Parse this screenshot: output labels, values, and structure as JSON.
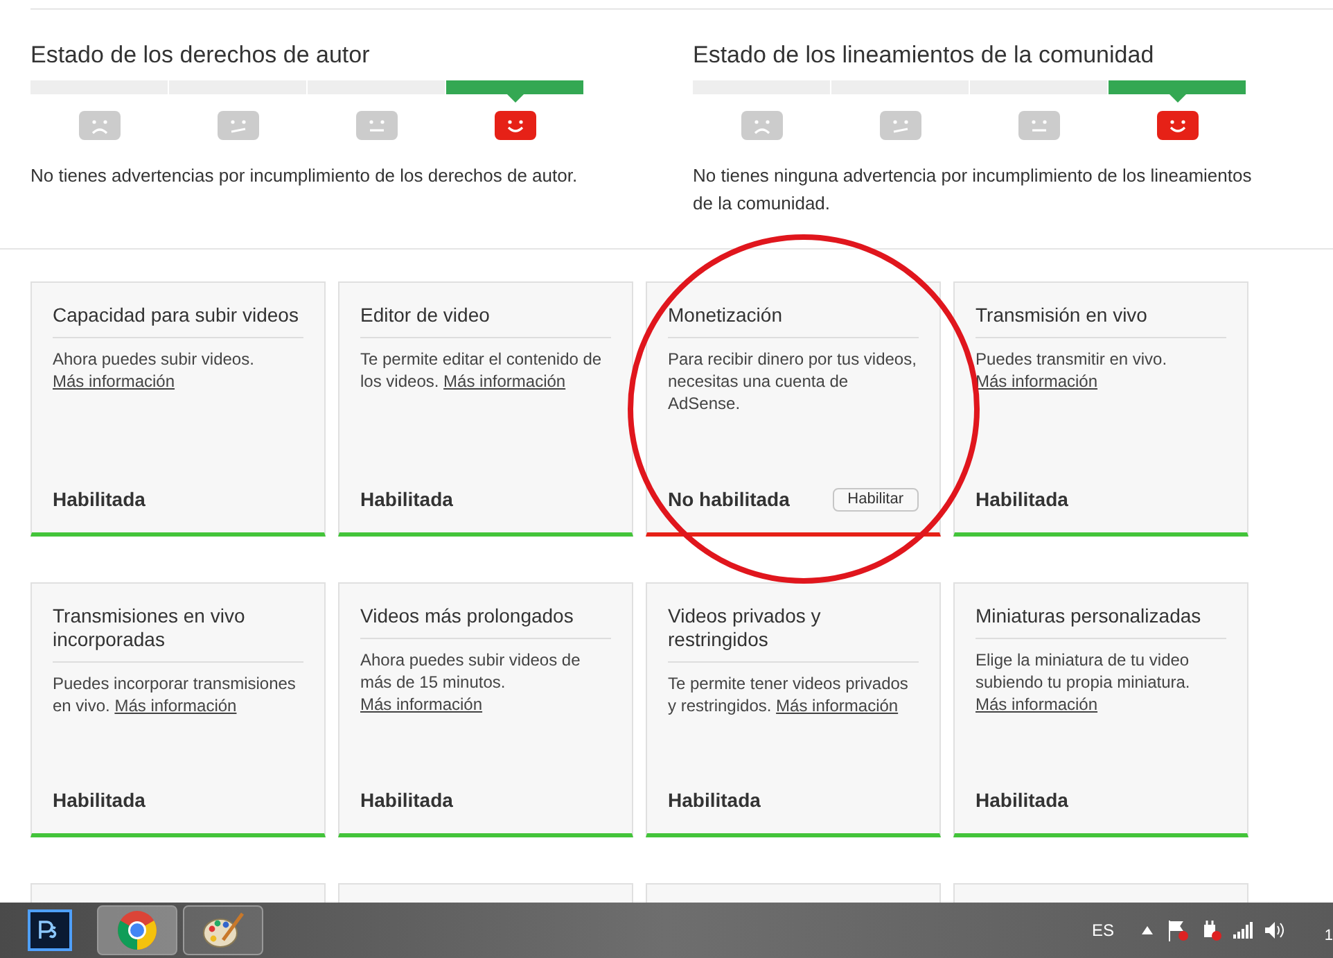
{
  "status_sections": [
    {
      "title": "Estado de los derechos de autor",
      "message": "No tienes advertencias por incumplimiento de los derechos de autor.",
      "levels": [
        {
          "kind": "sad",
          "selected": false
        },
        {
          "kind": "meh",
          "selected": false
        },
        {
          "kind": "neutral",
          "selected": false
        },
        {
          "kind": "happy",
          "selected": true
        }
      ]
    },
    {
      "title": "Estado de los lineamientos de la comunidad",
      "message": "No tienes ninguna advertencia por incumplimiento de los lineamientos de la comunidad.",
      "levels": [
        {
          "kind": "sad",
          "selected": false
        },
        {
          "kind": "meh",
          "selected": false
        },
        {
          "kind": "neutral",
          "selected": false
        },
        {
          "kind": "happy",
          "selected": true
        }
      ]
    }
  ],
  "feature_cards": [
    {
      "kind": "card",
      "title": "Capacidad para subir videos",
      "description": "Ahora puedes subir videos.",
      "link": "Más información",
      "status": "Habilitada",
      "enabled": true
    },
    {
      "kind": "card",
      "title": "Editor de video",
      "description": "Te permite editar el contenido de los videos.",
      "link": "Más información",
      "status": "Habilitada",
      "enabled": true
    },
    {
      "kind": "card",
      "title": "Monetización",
      "description": "Para recibir dinero por tus videos, necesitas una cuenta de AdSense.",
      "status": "No habilitada",
      "enabled": false,
      "button": "Habilitar"
    },
    {
      "kind": "card",
      "title": "Transmisión en vivo",
      "description": "Puedes transmitir en vivo.",
      "link": "Más información",
      "status": "Habilitada",
      "enabled": true
    },
    {
      "kind": "card",
      "title": "Transmisiones en vivo incorporadas",
      "description": "Puedes incorporar transmisiones en vivo.",
      "link": "Más información",
      "status": "Habilitada",
      "enabled": true
    },
    {
      "kind": "card",
      "title": "Videos más prolongados",
      "description": "Ahora puedes subir videos de más de 15 minutos.",
      "link": "Más información",
      "status": "Habilitada",
      "enabled": true
    },
    {
      "kind": "card",
      "title": "Videos privados y restringidos",
      "description": "Te permite tener videos privados y restringidos.",
      "link": "Más información",
      "status": "Habilitada",
      "enabled": true
    },
    {
      "kind": "card",
      "title": "Miniaturas personalizadas",
      "description": "Elige la miniatura de tu video subiendo tu propia miniatura.",
      "link": "Más información",
      "status": "Habilitada",
      "enabled": true
    },
    {
      "kind": "cut"
    },
    {
      "kind": "cut"
    },
    {
      "kind": "cut"
    },
    {
      "kind": "cut"
    }
  ],
  "taskbar": {
    "language": "ES",
    "clock": "1"
  }
}
